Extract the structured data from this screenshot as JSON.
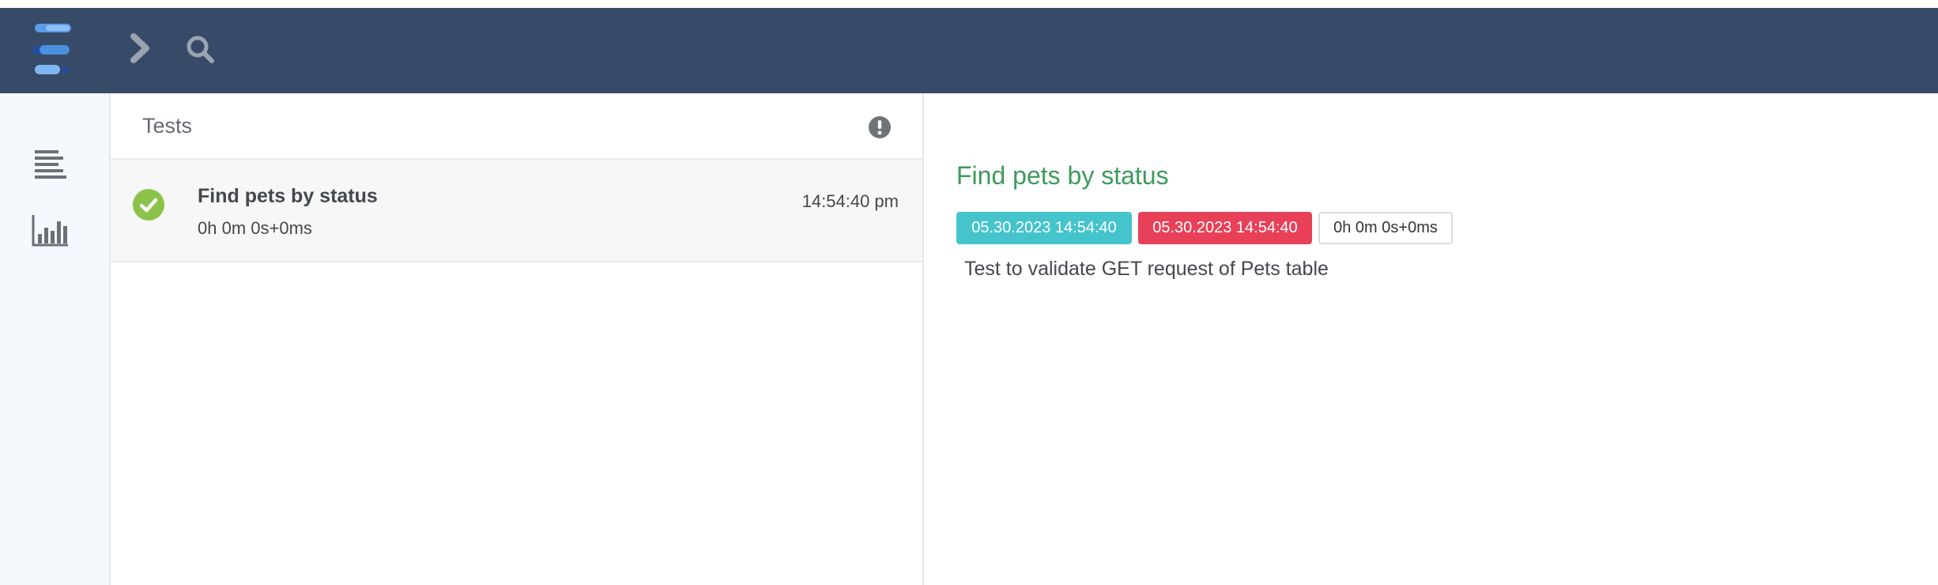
{
  "header": {
    "logo_icon": "extent-logo-icon",
    "nav_icons": [
      "chevron-right-icon",
      "search-icon"
    ]
  },
  "sidebar": {
    "items": [
      {
        "icon": "list-icon"
      },
      {
        "icon": "bar-chart-icon"
      }
    ]
  },
  "tests_panel": {
    "title": "Tests",
    "alert_icon": "exclamation-circle-icon",
    "tests": [
      {
        "status": "pass",
        "name": "Find pets by status",
        "duration": "0h 0m 0s+0ms",
        "time": "14:54:40 pm"
      }
    ]
  },
  "detail": {
    "title": "Find pets by status",
    "start_time": "05.30.2023 14:54:40",
    "end_time": "05.30.2023 14:54:40",
    "duration": "0h 0m 0s+0ms",
    "description": "Test to validate GET request of Pets table"
  },
  "colors": {
    "header_bg": "#374a67",
    "pass": "#8bc34a",
    "title_green": "#3d9a5c",
    "start_badge": "#45c4cc",
    "end_badge": "#e84058"
  }
}
